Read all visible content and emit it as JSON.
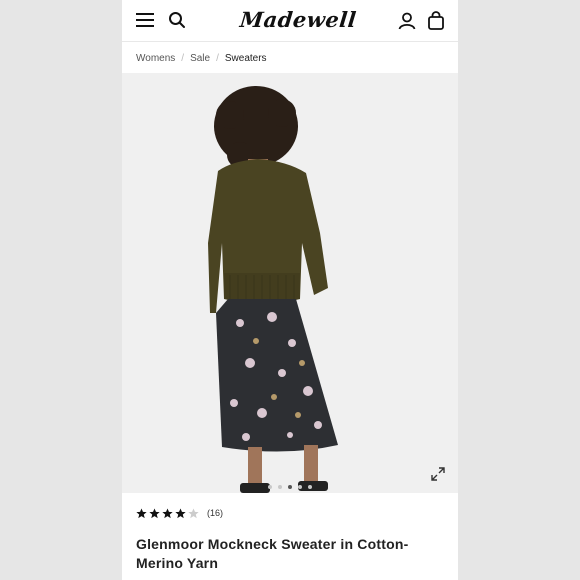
{
  "header": {
    "logo_text": "Madewell",
    "menu_icon": "menu-icon",
    "search_icon": "search-icon",
    "account_icon": "account-icon",
    "bag_icon": "bag-icon"
  },
  "breadcrumb": {
    "items": [
      "Womens",
      "Sale",
      "Sweaters"
    ]
  },
  "gallery": {
    "image_alt": "",
    "expand_icon": "expand-icon",
    "dot_count": 5,
    "active_dot": 2
  },
  "product": {
    "rating": 4,
    "rating_max": 5,
    "review_count": "(16)",
    "title": "Glenmoor Mockneck Sweater in Cotton-Merino Yarn"
  },
  "colors": {
    "background": "#e6e6e6",
    "page": "#ffffff",
    "star_filled": "#111111",
    "star_empty": "#cccccc"
  }
}
